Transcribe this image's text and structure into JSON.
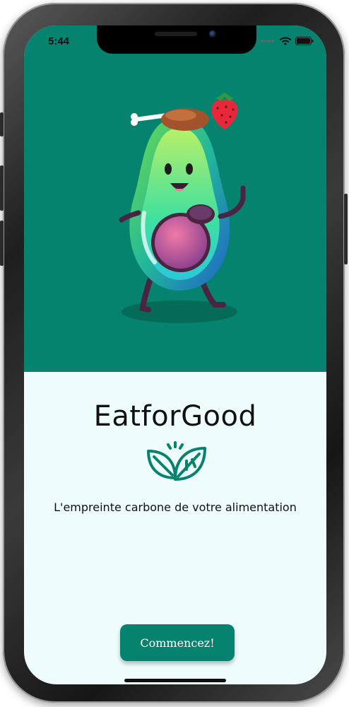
{
  "status_bar": {
    "time": "5:44",
    "icons": [
      "signal-dots-icon",
      "wifi-icon",
      "battery-icon"
    ]
  },
  "hero": {
    "background_color": "#06836e",
    "illustration": "avocado-mascot-with-drumstick-strawberry-plum"
  },
  "app": {
    "title": "EatforGood",
    "logo_icon": "leaf-logo-icon",
    "tagline": "L'empreinte carbone de votre alimentation"
  },
  "actions": {
    "start_label": "Commencez!"
  },
  "colors": {
    "accent": "#06836e",
    "background": "#eefcfc",
    "text": "#111111"
  }
}
